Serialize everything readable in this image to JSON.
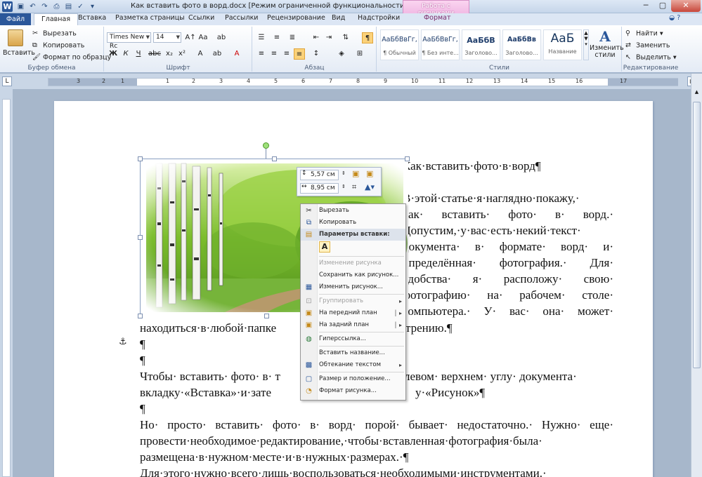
{
  "window": {
    "title": "Как вставить фото в ворд.docx [Режим ограниченной функциональности]  -  Microsof...",
    "context_tab_group": "Работа с рисунками",
    "qat_icons": [
      "save-icon",
      "undo-icon",
      "redo-icon",
      "print-icon",
      "print-preview-icon",
      "spelling-icon",
      "customize-icon"
    ]
  },
  "tabs": {
    "file": "Файл",
    "items": [
      "Главная",
      "Вставка",
      "Разметка страницы",
      "Ссылки",
      "Рассылки",
      "Рецензирование",
      "Вид",
      "Надстройки",
      "Формат"
    ],
    "active": "Главная"
  },
  "ribbon": {
    "clipboard": {
      "paste": "Вставить",
      "cut": "Вырезать",
      "copy": "Копировать",
      "format_painter": "Формат по образцу",
      "label": "Буфер обмена"
    },
    "font": {
      "name": "Times New Rc",
      "size": "14",
      "label": "Шрифт"
    },
    "paragraph": {
      "label": "Абзац"
    },
    "styles": {
      "label": "Стили",
      "items": [
        {
          "sample": "АаБбВвГг,",
          "name": "¶ Обычный"
        },
        {
          "sample": "АаБбВвГг,",
          "name": "¶ Без инте..."
        },
        {
          "sample": "АаБбВ",
          "name": "Заголово..."
        },
        {
          "sample": "АаБбВв",
          "name": "Заголово..."
        },
        {
          "sample": "АаБ",
          "name": "Название"
        }
      ],
      "change": "Изменить стили"
    },
    "editing": {
      "find": "Найти",
      "replace": "Заменить",
      "select": "Выделить",
      "label": "Редактирование"
    }
  },
  "ruler": {
    "numbers": [
      "3",
      "2",
      "1",
      "1",
      "2",
      "3",
      "4",
      "5",
      "6",
      "7",
      "8",
      "9",
      "10",
      "11",
      "12",
      "13",
      "14",
      "15",
      "16",
      "17"
    ]
  },
  "mini_toolbar": {
    "height_value": "5,57 см",
    "width_value": "8,95 см"
  },
  "context_menu": {
    "items": [
      {
        "label": "Вырезать",
        "icon": "scissors-icon",
        "enabled": true
      },
      {
        "label": "Копировать",
        "icon": "copy-icon",
        "enabled": true
      },
      {
        "label": "Параметры вставки:",
        "icon": "paste-icon",
        "header": true
      },
      {
        "label": "Изменение рисунка",
        "enabled": false
      },
      {
        "label": "Сохранить как рисунок...",
        "enabled": true
      },
      {
        "label": "Изменить рисунок...",
        "icon": "change-picture-icon",
        "enabled": true
      },
      {
        "label": "Группировать",
        "icon": "group-icon",
        "enabled": false,
        "submenu": true
      },
      {
        "label": "На передний план",
        "icon": "bring-front-icon",
        "enabled": true,
        "submenu": true
      },
      {
        "label": "На задний план",
        "icon": "send-back-icon",
        "enabled": true,
        "submenu": true
      },
      {
        "label": "Гиперссылка...",
        "icon": "hyperlink-icon",
        "enabled": true
      },
      {
        "label": "Вставить название...",
        "enabled": true
      },
      {
        "label": "Обтекание текстом",
        "icon": "text-wrap-icon",
        "enabled": true,
        "submenu": true
      },
      {
        "label": "Размер и положение...",
        "icon": "size-position-icon",
        "enabled": true
      },
      {
        "label": "Формат рисунка...",
        "icon": "format-picture-icon",
        "enabled": true
      }
    ],
    "paste_option": "A"
  },
  "document": {
    "lines": [
      "Как·вставить·фото·в·ворд¶",
      "¶",
      "В·этой·статье·я·наглядно·покажу,·",
      "как·  вставить·  фото·  в·  ворд.·",
      "Допустим,·у·вас·есть·некий·текст·",
      "документа·  в·  формате·  ворд·  и·",
      "определённая·  фотография.·  Для·",
      "удобства·  я·  расположу·  свою·",
      "фотографию·  на·  рабочем·  столе·",
      "компьютера.·  У·  вас·  она·  может·",
      "находиться·в·любой·папке",
      "трению.¶",
      "¶",
      "¶",
      "Чтобы·  вставить·  фото·  в·  т",
      "левом·  верхнем·  углу·  документа·",
      "вкладку·«Вставка»·и·зате",
      "у·«Рисунок»¶",
      "¶",
      "Но·  просто·  вставить·  фото·  в·  ворд·  порой·  бывает·  недостаточно.·  Нужно·  еще·",
      "провести·необходимое·редактирование,·чтобы·вставленная·фотография·была·",
      "размещена·в·нужном·месте·и·в·нужных·размерах.·¶",
      "Для·этого·нужно·всего·лишь·воспользоваться·необходимыми·инструментами.·"
    ],
    "anchor": "⚓"
  }
}
